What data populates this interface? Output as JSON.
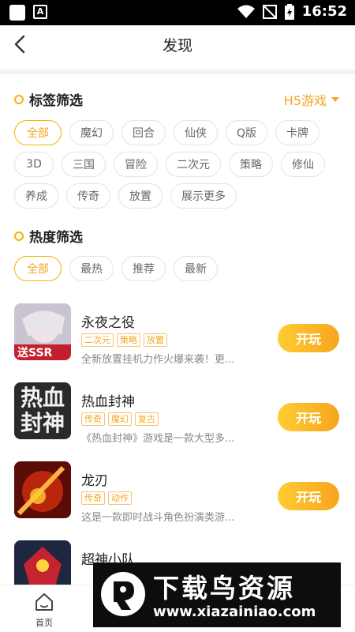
{
  "status_bar": {
    "time": "16:52"
  },
  "header": {
    "title": "发现"
  },
  "tag_filter": {
    "title": "标签筛选",
    "platform_selector": "H5游戏",
    "chips": [
      "全部",
      "魔幻",
      "回合",
      "仙侠",
      "Q版",
      "卡牌",
      "3D",
      "三国",
      "冒险",
      "二次元",
      "策略",
      "修仙",
      "养成",
      "传奇",
      "放置",
      "展示更多"
    ],
    "active_index": 0
  },
  "heat_filter": {
    "title": "热度筛选",
    "chips": [
      "全部",
      "最热",
      "推荐",
      "最新"
    ],
    "active_index": 0
  },
  "games": [
    {
      "name": "永夜之役",
      "tags": [
        "二次元",
        "策略",
        "放置"
      ],
      "desc": "全新放置挂机力作火爆来袭！更...",
      "play_label": "开玩",
      "thumb_text": "送SSR"
    },
    {
      "name": "热血封神",
      "tags": [
        "传奇",
        "魔幻",
        "复古"
      ],
      "desc": "《热血封神》游戏是一款大型多...",
      "play_label": "开玩",
      "thumb_text": "热血封神"
    },
    {
      "name": "龙刃",
      "tags": [
        "传奇",
        "动作"
      ],
      "desc": "这是一款即时战斗角色扮演类游...",
      "play_label": "开玩",
      "thumb_text": ""
    },
    {
      "name": "超神小队",
      "tags": [],
      "desc": "",
      "play_label": "",
      "thumb_text": ""
    }
  ],
  "tabbar": {
    "home_label": "首页"
  },
  "watermark": {
    "title": "下载鸟资源",
    "url": "www.xiazainiao.com"
  },
  "colors": {
    "accent": "#f5a623",
    "button_gradient_start": "#ffcc33",
    "button_gradient_end": "#f7a51e"
  }
}
